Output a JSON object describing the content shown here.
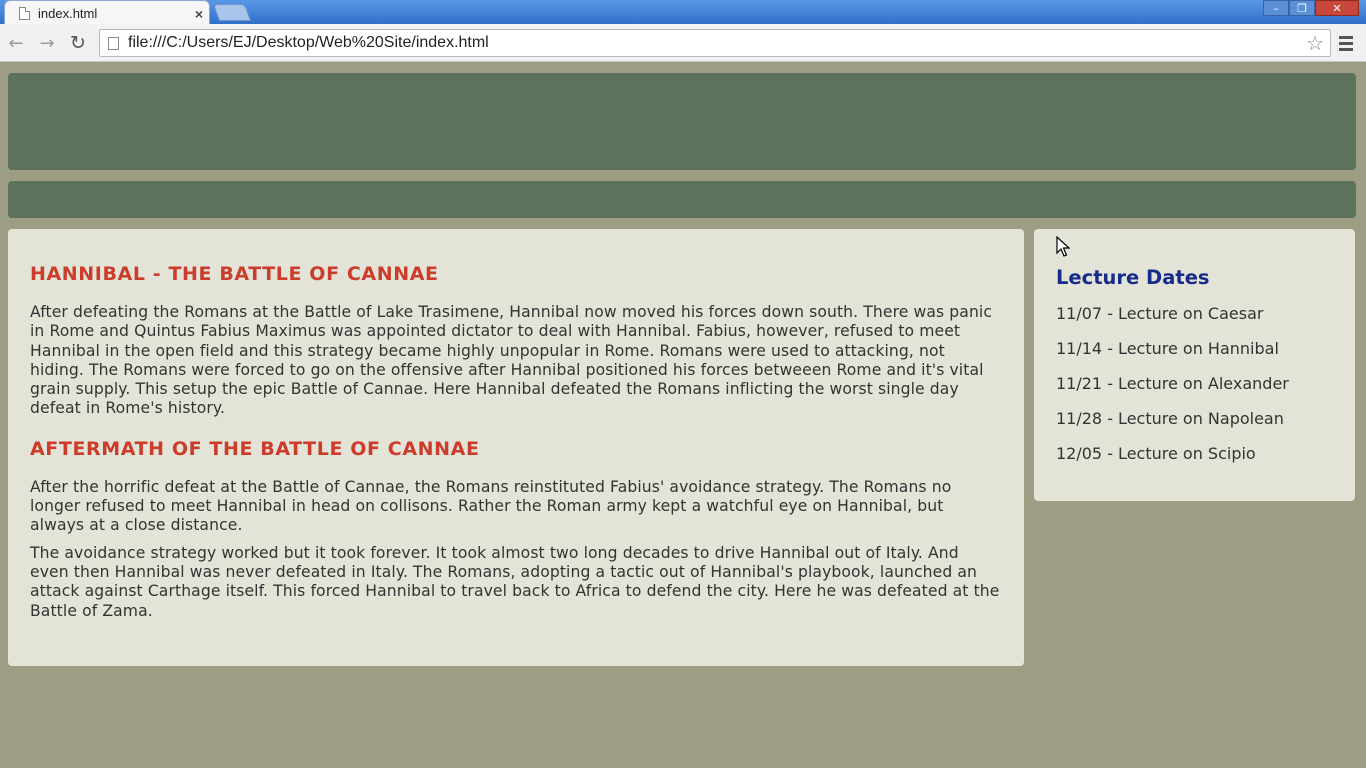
{
  "browser": {
    "tab_title": "index.html",
    "tab_close": "×",
    "url": "file:///C:/Users/EJ/Desktop/Web%20Site/index.html",
    "icons": {
      "back": "←",
      "forward": "→",
      "reload": "↻",
      "star": "☆",
      "minimize": "–",
      "maximize": "❐",
      "close": "✕"
    }
  },
  "main": {
    "heading1": "HANNIBAL - THE BATTLE OF CANNAE",
    "paragraph1": "After defeating the Romans at the Battle of Lake Trasimene, Hannibal now moved his forces down south. There was panic in Rome and Quintus Fabius Maximus was appointed dictator to deal with Hannibal. Fabius, however, refused to meet Hannibal in the open field and this strategy became highly unpopular in Rome. Romans were used to attacking, not hiding. The Romans were forced to go on the offensive after Hannibal positioned his forces betweeen Rome and it's vital grain supply. This setup the epic Battle of Cannae. Here Hannibal defeated the Romans inflicting the worst single day defeat in Rome's history.",
    "heading2": "AFTERMATH OF THE BATTLE OF CANNAE",
    "paragraph2": "After the horrific defeat at the Battle of Cannae, the Romans reinstituted Fabius' avoidance strategy. The Romans no longer refused to meet Hannibal in head on collisons. Rather the Roman army kept a watchful eye on Hannibal, but always at a close distance.",
    "paragraph3": "The avoidance strategy worked but it took forever. It took almost two long decades to drive Hannibal out of Italy. And even then Hannibal was never defeated in Italy. The Romans, adopting a tactic out of Hannibal's playbook, launched an attack against Carthage itself. This forced Hannibal to travel back to Africa to defend the city. Here he was defeated at the Battle of Zama."
  },
  "sidebar": {
    "title": "Lecture Dates",
    "items": [
      "11/07 - Lecture on Caesar",
      "11/14 - Lecture on Hannibal",
      "11/21 - Lecture on Alexander",
      "11/28 - Lecture on Napolean",
      "12/05 - Lecture on Scipio"
    ]
  },
  "colors": {
    "page_bg": "#9c9d83",
    "bar_green": "#5d725d",
    "panel_bg": "#e4e3d8",
    "heading_red": "#cc3c2a",
    "heading_blue": "#162c8a"
  }
}
